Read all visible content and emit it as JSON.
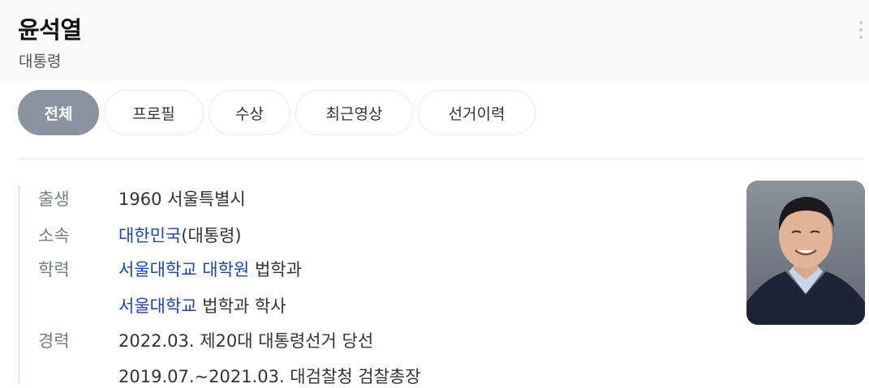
{
  "header": {
    "title": "윤석열",
    "subtitle": "대통령"
  },
  "tabs": [
    {
      "label": "전체",
      "active": true
    },
    {
      "label": "프로필",
      "active": false
    },
    {
      "label": "수상",
      "active": false
    },
    {
      "label": "최근영상",
      "active": false
    },
    {
      "label": "선거이력",
      "active": false
    }
  ],
  "info": {
    "birth": {
      "label": "출생",
      "value": "1960 서울특별시"
    },
    "affiliation": {
      "label": "소속",
      "link": "대한민국",
      "suffix": "(대통령)"
    },
    "education": {
      "label": "학력",
      "entries": [
        {
          "link1": "서울대학교",
          "link2": "대학원",
          "text": "법학과"
        },
        {
          "link1": "서울대학교",
          "text": "법학과 학사"
        }
      ]
    },
    "career": {
      "label": "경력",
      "entries": [
        "2022.03. 제20대 대통령선거 당선",
        "2019.07.~2021.03. 대검찰청 검찰총장"
      ]
    }
  },
  "colors": {
    "link": "#1a44b3",
    "active_tab": "#8a93a0",
    "label_gray": "#767b85"
  },
  "icons": {
    "more": "more-vertical-icon"
  }
}
